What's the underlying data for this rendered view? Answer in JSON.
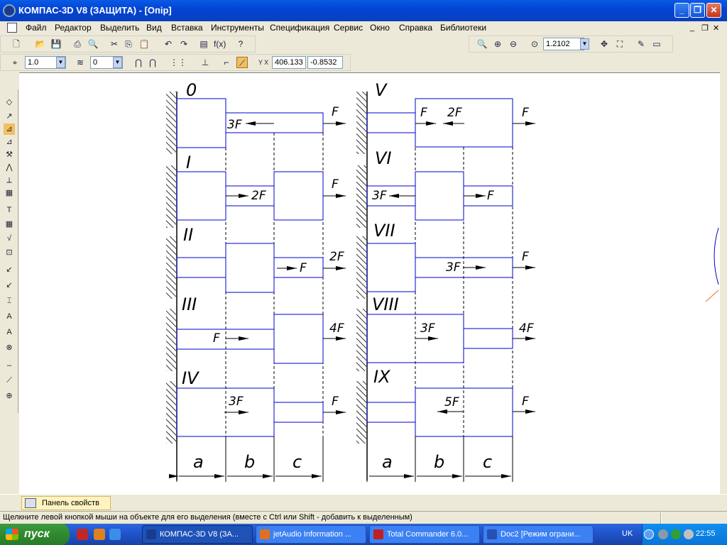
{
  "window": {
    "title": "КОМПАС-3D V8 (ЗАЩИТА) - [Опір]",
    "min_label": "_",
    "max_label": "❐",
    "close_label": "✕"
  },
  "menu": [
    "Файл",
    "Редактор",
    "Выделить",
    "Вид",
    "Вставка",
    "Инструменты",
    "Спецификация",
    "Сервис",
    "Окно",
    "Справка",
    "Библиотеки"
  ],
  "toolbar": {
    "zoom_value": "1.2102",
    "step_value": "1.0",
    "layer_value": "0",
    "coord_x": "406.133",
    "coord_y": "-0.8532"
  },
  "panel_tab": "Панель свойств",
  "status_text": "Щелкните левой кнопкой мыши на объекте для его выделения (вместе с Ctrl или Shift - добавить к выделенным)",
  "taskbar": {
    "start_label": "пуск",
    "tasks": [
      "КОМПАС-3D V8 (ЗА...",
      "jetAudio Information ...",
      "Total Commander 6.0...",
      "Doc2 [Режим ограни..."
    ],
    "lang": "UK",
    "time": "22:55"
  },
  "drawing": {
    "schemes": [
      {
        "label": "0",
        "left": [
          ""
        ],
        "f_left": "3F",
        "f_right": "F"
      },
      {
        "label": "I",
        "f_mid": "2F",
        "f_right": "F"
      },
      {
        "label": "II",
        "f_mid": "F",
        "f_right": "2F"
      },
      {
        "label": "III",
        "f_mid": "F",
        "f_right": "4F"
      },
      {
        "label": "IV",
        "f_mid": "3F",
        "f_right": "F"
      },
      {
        "label": "V",
        "f_left": "F",
        "f_mid": "2F",
        "f_right": "F"
      },
      {
        "label": "VI",
        "f_left": "3F",
        "f_mid": "F"
      },
      {
        "label": "VII",
        "f_mid": "3F",
        "f_right": "F"
      },
      {
        "label": "VIII",
        "f_mid": "3F",
        "f_right": "4F"
      },
      {
        "label": "IX",
        "f_mid": "5F",
        "f_right": "F"
      }
    ],
    "dims": [
      "a",
      "b",
      "c"
    ]
  }
}
